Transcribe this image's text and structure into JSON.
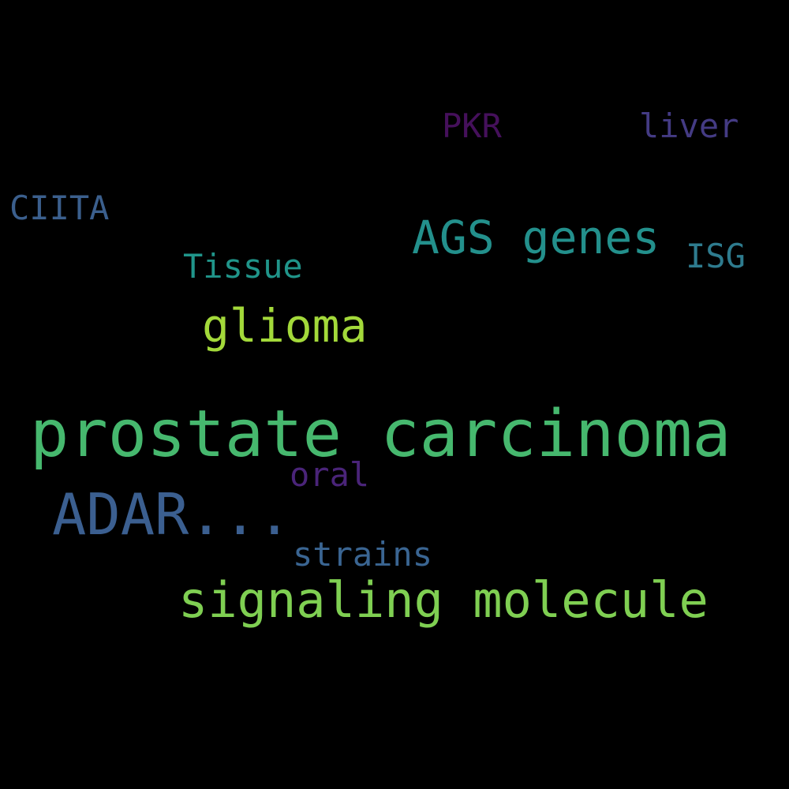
{
  "background": "#000000",
  "words": {
    "prostate_carcinoma": {
      "text": "prostate carcinoma",
      "color": "#46b86e"
    },
    "adar": {
      "text": "ADAR...",
      "color": "#3b5f90"
    },
    "signaling_molecule": {
      "text": "signaling molecule",
      "color": "#7fcf52"
    },
    "ags_genes": {
      "text": "AGS genes",
      "color": "#23908c"
    },
    "glioma": {
      "text": "glioma",
      "color": "#a3d93a"
    },
    "tissue": {
      "text": "Tissue",
      "color": "#20958a"
    },
    "strains": {
      "text": "strains",
      "color": "#3a6592"
    },
    "ciita": {
      "text": "CIITA",
      "color": "#3b5f8d"
    },
    "isg": {
      "text": "ISG",
      "color": "#2e7b8e"
    },
    "liver": {
      "text": "liver",
      "color": "#443b84"
    },
    "pkr": {
      "text": "PKR",
      "color": "#45105b"
    },
    "oral": {
      "text": "oral",
      "color": "#4a2479"
    }
  }
}
